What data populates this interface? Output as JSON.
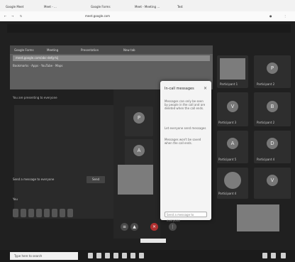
{
  "outer_browser": {
    "tabs": [
      "Google Meet",
      "Meet - ...",
      "Google Forms",
      "Meet - Meeting ...",
      "Test"
    ],
    "address": "meet.google.com"
  },
  "meet": {
    "presenting_label": "You are presenting to everyone",
    "inner_tabs": [
      "Google Forms",
      "Meeting",
      "Presentation",
      "New tab"
    ],
    "inner_address": "meet.google.com/abc-defg-hij",
    "inner_bookmarks": "Bookmarks  ·  Apps  ·  YouTube  ·  Maps",
    "chat_hint": "Send a message to everyone",
    "chat_button": "Send",
    "you_label": "You",
    "participants": [
      {
        "name": "Participant 1",
        "initial": "P"
      },
      {
        "name": "Participant 2",
        "initial": "B"
      },
      {
        "name": "Participant 3",
        "initial": "V"
      },
      {
        "name": "Participant 4",
        "initial": "D"
      },
      {
        "name": "Participant 5",
        "initial": "A"
      }
    ],
    "popup": {
      "title": "In-call messages",
      "paragraph1": "Messages can only be seen by people in the call and are deleted when the call ends.",
      "paragraph2": "Let everyone send messages",
      "paragraph3": "Messages won't be saved when the call ends.",
      "placeholder": "Send a message to everyone"
    }
  },
  "taskbar": {
    "search_placeholder": "Type here to search"
  }
}
